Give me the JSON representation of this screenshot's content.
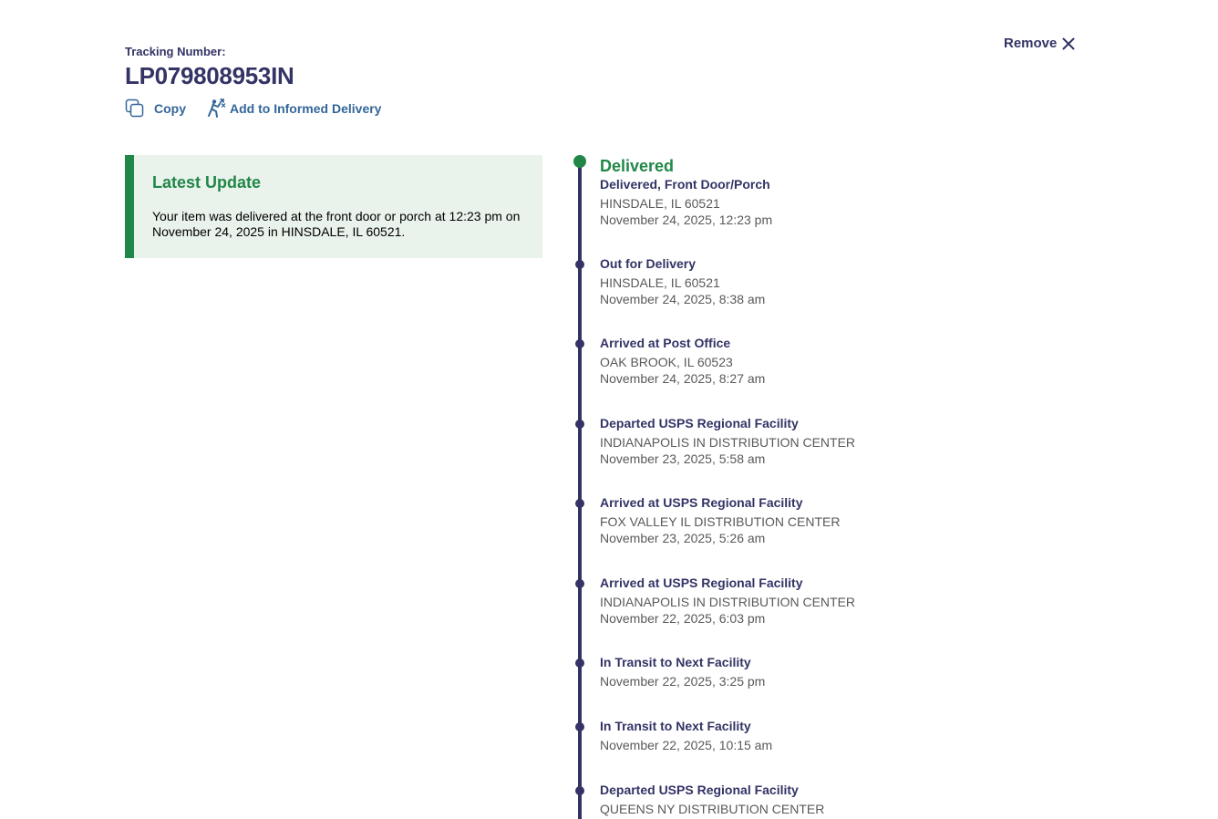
{
  "header": {
    "tracking_label": "Tracking Number:",
    "tracking_number": "LP079808953IN",
    "copy_label": "Copy",
    "copy_icon": "copy-icon",
    "informed_label": "Add to Informed Delivery",
    "informed_icon": "informed-delivery-icon",
    "remove_label": "Remove",
    "remove_icon": "close-icon"
  },
  "latest_update": {
    "title": "Latest Update",
    "text": "Your item was delivered at the front door or porch at 12:23 pm on November 24, 2025 in HINSDALE, IL 60521."
  },
  "colors": {
    "navy": "#333366",
    "green": "#218748",
    "link": "#336699",
    "latest_bg": "#eaf2ec",
    "gray_text": "#595959"
  },
  "events": [
    {
      "status": "Delivered",
      "detail": "Delivered, Front Door/Porch",
      "location": "HINSDALE, IL 60521",
      "time": "November 24, 2025, 12:23 pm"
    },
    {
      "status": "Out for Delivery",
      "location": "HINSDALE, IL 60521",
      "time": "November 24, 2025, 8:38 am"
    },
    {
      "status": "Arrived at Post Office",
      "location": "OAK BROOK, IL 60523",
      "time": "November 24, 2025, 8:27 am"
    },
    {
      "status": "Departed USPS Regional Facility",
      "location": "INDIANAPOLIS IN DISTRIBUTION CENTER",
      "time": "November 23, 2025, 5:58 am"
    },
    {
      "status": "Arrived at USPS Regional Facility",
      "location": "FOX VALLEY IL DISTRIBUTION CENTER",
      "time": "November 23, 2025, 5:26 am"
    },
    {
      "status": "Arrived at USPS Regional Facility",
      "location": "INDIANAPOLIS IN DISTRIBUTION CENTER",
      "time": "November 22, 2025, 6:03 pm"
    },
    {
      "status": "In Transit to Next Facility",
      "time": "November 22, 2025, 3:25 pm"
    },
    {
      "status": "In Transit to Next Facility",
      "time": "November 22, 2025, 10:15 am"
    },
    {
      "status": "Departed USPS Regional Facility",
      "location": "QUEENS NY DISTRIBUTION CENTER"
    }
  ]
}
